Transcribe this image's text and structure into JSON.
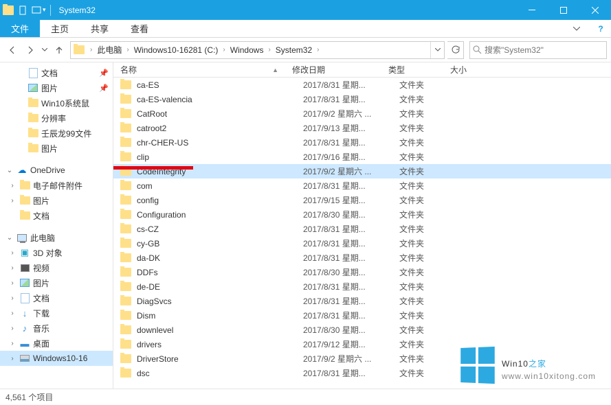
{
  "window": {
    "title": "System32"
  },
  "tabs": {
    "file": "文件",
    "home": "主页",
    "share": "共享",
    "view": "查看"
  },
  "breadcrumb": {
    "pc": "此电脑",
    "drive": "Windows10-16281 (C:)",
    "win": "Windows",
    "sys": "System32"
  },
  "search": {
    "placeholder": "搜索\"System32\""
  },
  "columns": {
    "name": "名称",
    "date": "修改日期",
    "type": "类型",
    "size": "大小"
  },
  "sidebar": {
    "docs": "文档",
    "pics": "图片",
    "win10mouse": "Win10系统鼠",
    "res": "分辨率",
    "ren99": "壬辰龙99文件",
    "pics2": "图片",
    "onedrive": "OneDrive",
    "email": "电子邮件附件",
    "pics3": "图片",
    "docs2": "文档",
    "thispc": "此电脑",
    "d3d": "3D 对象",
    "video": "视频",
    "pics4": "图片",
    "docs3": "文档",
    "down": "下载",
    "music": "音乐",
    "desk": "桌面",
    "cdrive": "Windows10-16"
  },
  "rows": [
    {
      "name": "ca-ES",
      "date": "2017/8/31 星期...",
      "type": "文件夹"
    },
    {
      "name": "ca-ES-valencia",
      "date": "2017/8/31 星期...",
      "type": "文件夹"
    },
    {
      "name": "CatRoot",
      "date": "2017/9/2 星期六 ...",
      "type": "文件夹"
    },
    {
      "name": "catroot2",
      "date": "2017/9/13 星期...",
      "type": "文件夹"
    },
    {
      "name": "chr-CHER-US",
      "date": "2017/8/31 星期...",
      "type": "文件夹"
    },
    {
      "name": "clip",
      "date": "2017/9/16 星期...",
      "type": "文件夹"
    },
    {
      "name": "CodeIntegrity",
      "date": "2017/9/2 星期六 ...",
      "type": "文件夹",
      "selected": true
    },
    {
      "name": "com",
      "date": "2017/8/31 星期...",
      "type": "文件夹"
    },
    {
      "name": "config",
      "date": "2017/9/15 星期...",
      "type": "文件夹"
    },
    {
      "name": "Configuration",
      "date": "2017/8/30 星期...",
      "type": "文件夹"
    },
    {
      "name": "cs-CZ",
      "date": "2017/8/31 星期...",
      "type": "文件夹"
    },
    {
      "name": "cy-GB",
      "date": "2017/8/31 星期...",
      "type": "文件夹"
    },
    {
      "name": "da-DK",
      "date": "2017/8/31 星期...",
      "type": "文件夹"
    },
    {
      "name": "DDFs",
      "date": "2017/8/30 星期...",
      "type": "文件夹"
    },
    {
      "name": "de-DE",
      "date": "2017/8/31 星期...",
      "type": "文件夹"
    },
    {
      "name": "DiagSvcs",
      "date": "2017/8/31 星期...",
      "type": "文件夹"
    },
    {
      "name": "Dism",
      "date": "2017/8/31 星期...",
      "type": "文件夹"
    },
    {
      "name": "downlevel",
      "date": "2017/8/30 星期...",
      "type": "文件夹"
    },
    {
      "name": "drivers",
      "date": "2017/9/12 星期...",
      "type": "文件夹"
    },
    {
      "name": "DriverStore",
      "date": "2017/9/2 星期六 ...",
      "type": "文件夹"
    },
    {
      "name": "dsc",
      "date": "2017/8/31 星期...",
      "type": "文件夹"
    }
  ],
  "status": {
    "count": "4,561 个项目"
  },
  "watermark": {
    "main_pre": "Win10",
    "main_post": "之家",
    "sub": "www.win10xitong.com"
  }
}
